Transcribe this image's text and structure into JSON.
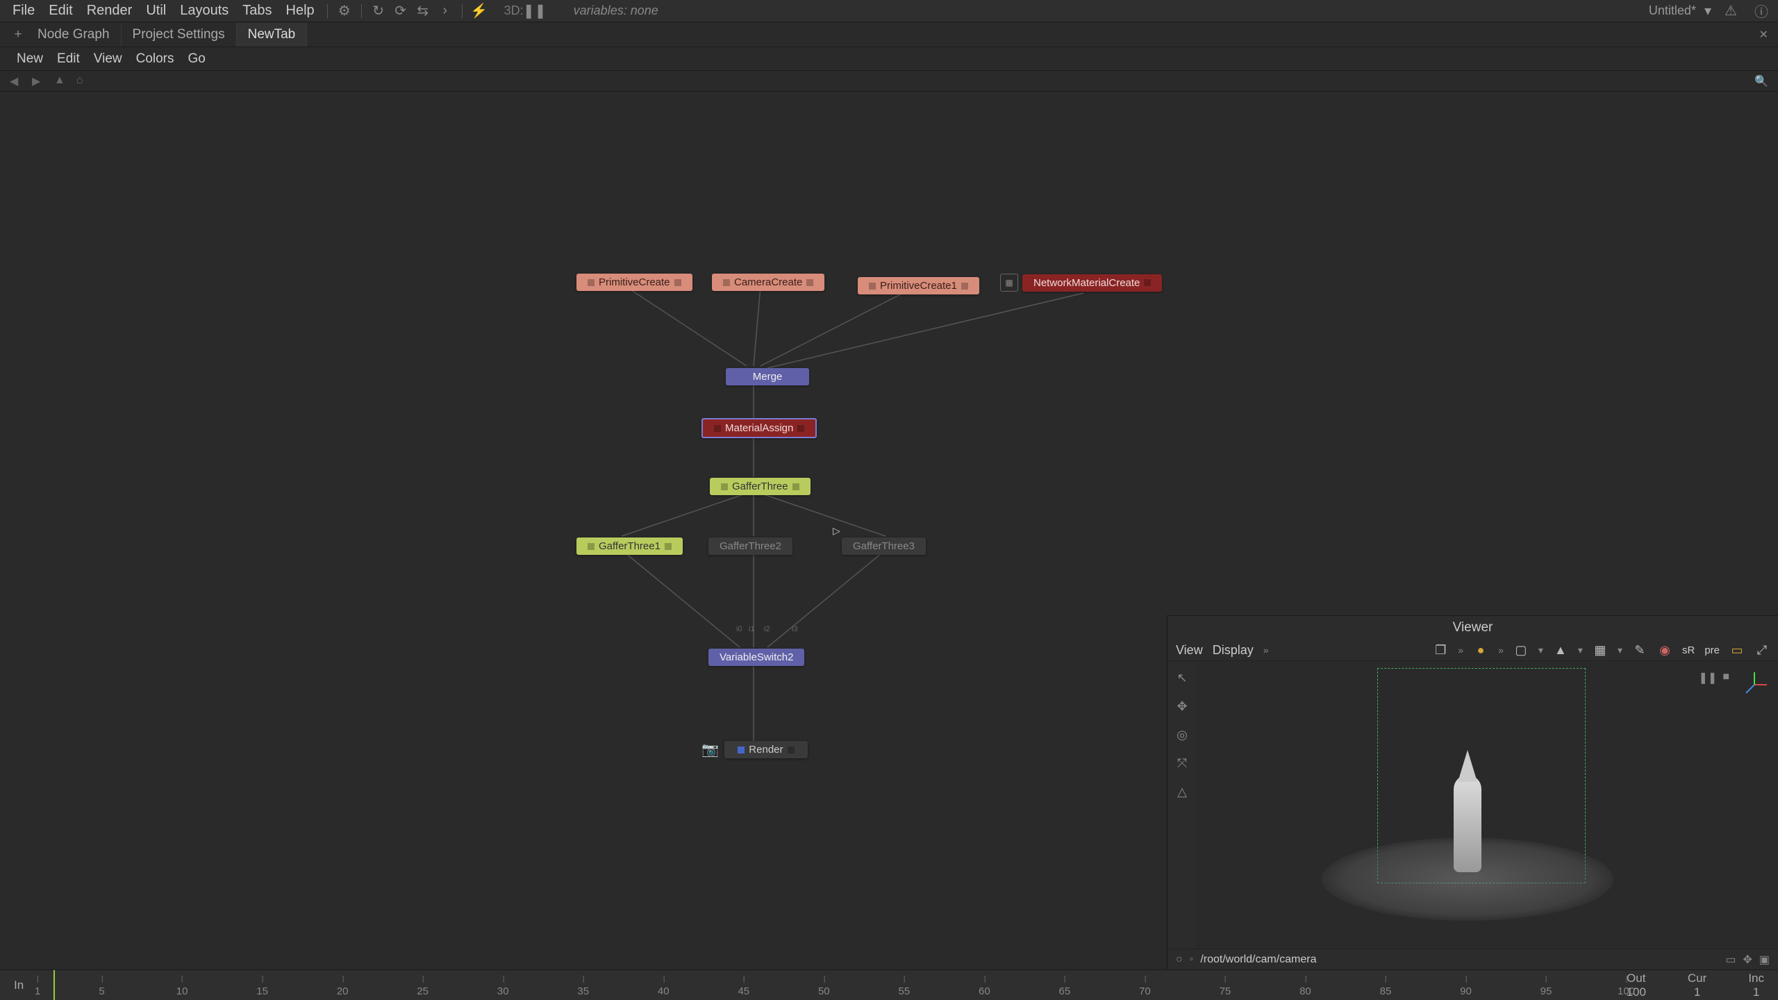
{
  "menubar": {
    "items": [
      "File",
      "Edit",
      "Render",
      "Util",
      "Layouts",
      "Tabs",
      "Help"
    ],
    "label_3d": "3D:",
    "variables": "variables: none",
    "doc_title": "Untitled*"
  },
  "tabs": {
    "items": [
      {
        "label": "Node Graph",
        "active": false
      },
      {
        "label": "Project Settings",
        "active": false
      },
      {
        "label": "NewTab",
        "active": true
      }
    ]
  },
  "submenu": {
    "items": [
      "New",
      "Edit",
      "View",
      "Colors",
      "Go"
    ]
  },
  "nodes": {
    "prim1": {
      "label": "PrimitiveCreate"
    },
    "cam": {
      "label": "CameraCreate"
    },
    "prim2": {
      "label": "PrimitiveCreate1"
    },
    "netmat": {
      "label": "NetworkMaterialCreate"
    },
    "merge": {
      "label": "Merge"
    },
    "matasn": {
      "label": "MaterialAssign"
    },
    "gaffer": {
      "label": "GafferThree"
    },
    "gaffer1": {
      "label": "GafferThree1"
    },
    "gaffer2": {
      "label": "GafferThree2"
    },
    "gaffer3": {
      "label": "GafferThree3"
    },
    "vswitch": {
      "label": "VariableSwitch2"
    },
    "render": {
      "label": "Render"
    },
    "port_i0": "i0",
    "port_i1": "i1",
    "port_i2": "i2",
    "port_i3": "i3"
  },
  "viewer": {
    "title": "Viewer",
    "menu": [
      "View",
      "Display"
    ],
    "sr_label": "sR",
    "pre_label": "pre",
    "camera_path": "/root/world/cam/camera"
  },
  "timeline": {
    "in": "In",
    "out": "Out",
    "cur": "Cur",
    "inc": "Inc",
    "first": "1",
    "last": "100",
    "curval": "1",
    "incval": "1",
    "ticks": [
      1,
      5,
      10,
      15,
      20,
      25,
      30,
      35,
      40,
      45,
      50,
      55,
      60,
      65,
      70,
      75,
      80,
      85,
      90,
      95,
      100
    ]
  }
}
